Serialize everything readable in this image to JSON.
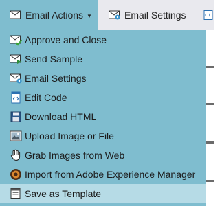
{
  "toolbar": {
    "email_actions_label": "Email Actions",
    "email_settings_label": "Email Settings"
  },
  "menu": {
    "items": [
      {
        "label": "Approve and Close",
        "icon": "envelope-check-icon"
      },
      {
        "label": "Send Sample",
        "icon": "envelope-send-icon"
      },
      {
        "label": "Email Settings",
        "icon": "envelope-settings-icon"
      },
      {
        "label": "Edit Code",
        "icon": "code-file-icon"
      },
      {
        "label": "Download HTML",
        "icon": "save-disk-icon"
      },
      {
        "label": "Upload Image or File",
        "icon": "image-upload-icon"
      },
      {
        "label": "Grab Images from Web",
        "icon": "hand-grab-icon"
      },
      {
        "label": "Import from Adobe Experience Manager",
        "icon": "adobe-aem-icon"
      },
      {
        "label": "Save as Template",
        "icon": "template-icon"
      }
    ],
    "highlighted_index": 8
  },
  "colors": {
    "menu_bg": "#7fbdcf",
    "menu_hover": "#b6dbe6",
    "toolbar_bg": "#e9e9ee"
  }
}
